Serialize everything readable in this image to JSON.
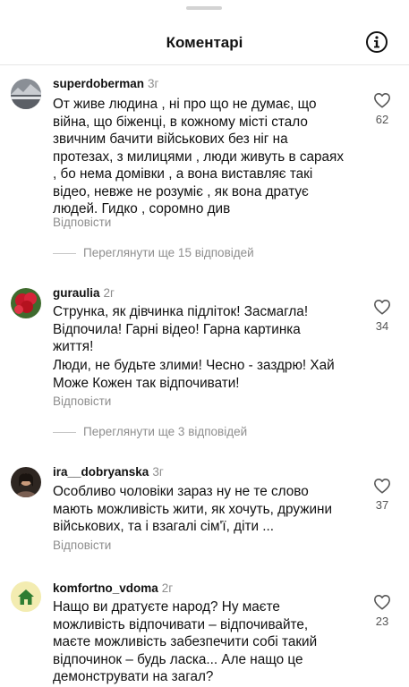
{
  "header": {
    "title": "Коментарі"
  },
  "comments": [
    {
      "user": "superdoberman",
      "age": "3г",
      "paragraphs": [
        "От живе людина , ні про що не думає, що війна, що біженці, в кожному місті стало звичним бачити військових без ніг на протезах, з милицями , люди живуть в сараях , бо нема домівки , а вона виставляє такі відео, невже не розуміє , як вона дратує людей. Гидко , соромно див"
      ],
      "likes": "62",
      "reply_label": "Відповісти",
      "view_more": "Переглянути ще 15 відповідей"
    },
    {
      "user": "guraulia",
      "age": "2г",
      "paragraphs": [
        "Струнка, як дівчинка підліток! Засмагла! Відпочила! Гарні відео! Гарна картинка життя!",
        "Люди, не будьте злими! Чесно - заздрю! Хай Може Кожен так відпочивати!"
      ],
      "likes": "34",
      "reply_label": "Відповісти",
      "view_more": "Переглянути ще 3 відповідей"
    },
    {
      "user": "ira__dobryanska",
      "age": "3г",
      "paragraphs": [
        "Особливо чоловіки зараз ну не те слово мають можливість жити, як хочуть, дружини військових, та і взагалі сім'ї, діти ..."
      ],
      "likes": "37",
      "reply_label": "Відповісти"
    },
    {
      "user": "komfortno_vdoma",
      "age": "2г",
      "paragraphs": [
        "Нащо ви дратуєте народ? Ну маєте можливість відпочивати – відпочивайте, маєте можливість забезпечити собі такий відпочинок –  будь ласка... Але нащо це демонструвати на загал?"
      ],
      "likes": "23"
    }
  ]
}
